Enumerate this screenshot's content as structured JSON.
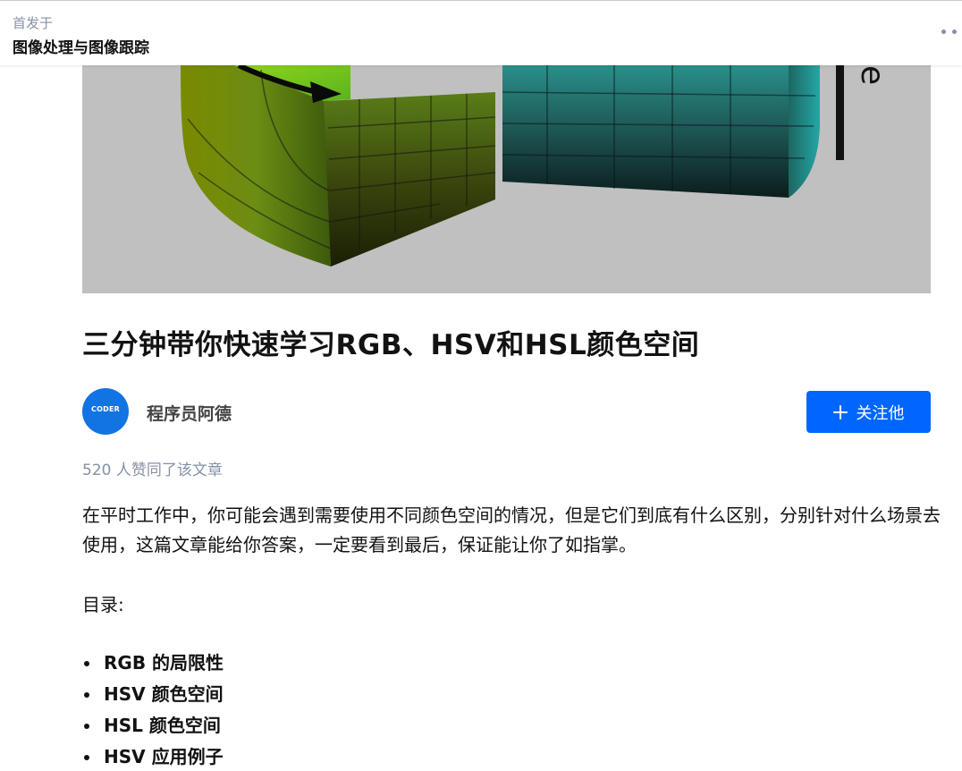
{
  "header": {
    "first_published_label": "首发于",
    "column_name": "图像处理与图像跟踪",
    "more_icon": "more-dots-icon"
  },
  "cover": {
    "description_icon": "hsv-cylinder-illustration",
    "axis_letter": "e"
  },
  "article": {
    "title": "三分钟带你快速学习RGB、HSV和HSL颜色空间",
    "author": {
      "avatar_text": "CODER",
      "name": "程序员阿德"
    },
    "follow_button": {
      "label": "关注他",
      "icon": "plus-icon",
      "color": "#0066ff"
    },
    "likes_text": "520 人赞同了该文章",
    "intro": "在平时工作中，你可能会遇到需要使用不同颜色空间的情况，但是它们到底有什么区别，分别针对什么场景去使用，这篇文章能给你答案，一定要看到最后，保证能让你了如指掌。",
    "toc_label": "目录:",
    "toc_items": [
      {
        "label": "RGB 的局限性"
      },
      {
        "label": "HSV 颜色空间"
      },
      {
        "label": "HSL 颜色空间"
      },
      {
        "label": "HSV 应用例子"
      }
    ]
  }
}
